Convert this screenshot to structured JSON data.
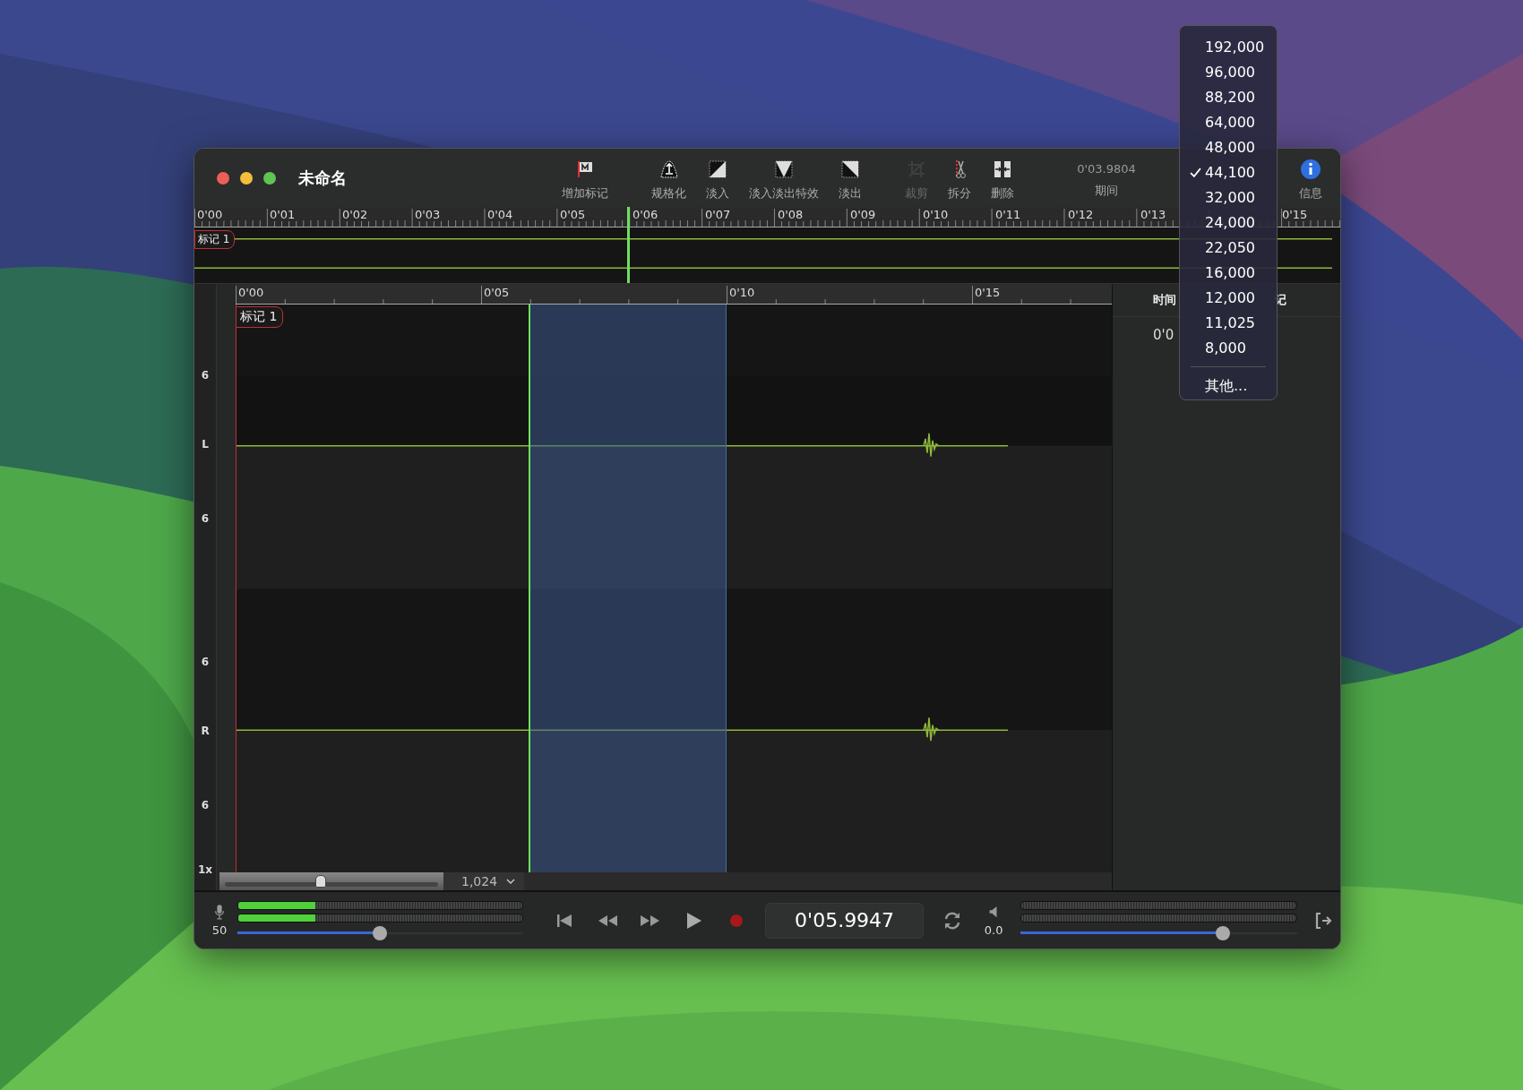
{
  "window": {
    "title": "未命名"
  },
  "toolbar": [
    {
      "kind": "marker",
      "label": "增加标记",
      "disabled": false
    },
    {
      "kind": "normalize",
      "label": "规格化",
      "disabled": false
    },
    {
      "kind": "fade_in",
      "label": "淡入",
      "disabled": false
    },
    {
      "kind": "crossfade",
      "label": "淡入淡出特效",
      "disabled": false
    },
    {
      "kind": "fade_out",
      "label": "淡出",
      "disabled": false
    },
    {
      "kind": "crop",
      "label": "裁剪",
      "disabled": true
    },
    {
      "kind": "split",
      "label": "拆分",
      "disabled": false
    },
    {
      "kind": "delete",
      "label": "删除",
      "disabled": false
    }
  ],
  "duration": {
    "value": "0'03.9804",
    "label": "期间"
  },
  "info_button": {
    "label": "信息"
  },
  "overview": {
    "ruler": [
      "0'00",
      "0'01",
      "0'02",
      "0'03",
      "0'04",
      "0'05",
      "0'06",
      "0'07",
      "0'08",
      "0'09",
      "0'10",
      "0'11",
      "0'12",
      "0'13"
    ],
    "ruler_end": "0'15",
    "marker": "标记 1"
  },
  "editor": {
    "ruler": [
      "0'00",
      "0'05",
      "0'10",
      "0'15"
    ],
    "marker": "标记 1",
    "scale_labels": [
      "6",
      "L",
      "6",
      "6",
      "R",
      "6"
    ],
    "zoom_label": "1x"
  },
  "marker_list": {
    "columns": [
      "时间",
      "记"
    ],
    "rows": [
      [
        "0'0"
      ]
    ]
  },
  "zoom_slider": {
    "level": 0.45
  },
  "block_size": "1,024",
  "input": {
    "reading": "50",
    "meters": [
      {
        "level": 0.27
      },
      {
        "level": 0.27
      }
    ],
    "volume": {
      "level": 0.5
    }
  },
  "transport": [
    {
      "kind": "to_start"
    },
    {
      "kind": "rewind"
    },
    {
      "kind": "forward"
    },
    {
      "kind": "play"
    },
    {
      "kind": "record"
    }
  ],
  "time": "0'05.9947",
  "output": {
    "reading": "0.0",
    "meters": [
      {
        "level": 0
      },
      {
        "level": 0
      }
    ],
    "volume": {
      "level": 0.73
    }
  },
  "sample_rate_menu": {
    "items": [
      {
        "label": "192,000",
        "selected": false
      },
      {
        "label": "96,000",
        "selected": false
      },
      {
        "label": "88,200",
        "selected": false
      },
      {
        "label": "64,000",
        "selected": false
      },
      {
        "label": "48,000",
        "selected": false
      },
      {
        "label": "44,100",
        "selected": true
      },
      {
        "label": "32,000",
        "selected": false
      },
      {
        "label": "24,000",
        "selected": false
      },
      {
        "label": "22,050",
        "selected": false
      },
      {
        "label": "16,000",
        "selected": false
      },
      {
        "label": "12,000",
        "selected": false
      },
      {
        "label": "11,025",
        "selected": false
      },
      {
        "label": "8,000",
        "selected": false
      }
    ],
    "other": "其他..."
  }
}
